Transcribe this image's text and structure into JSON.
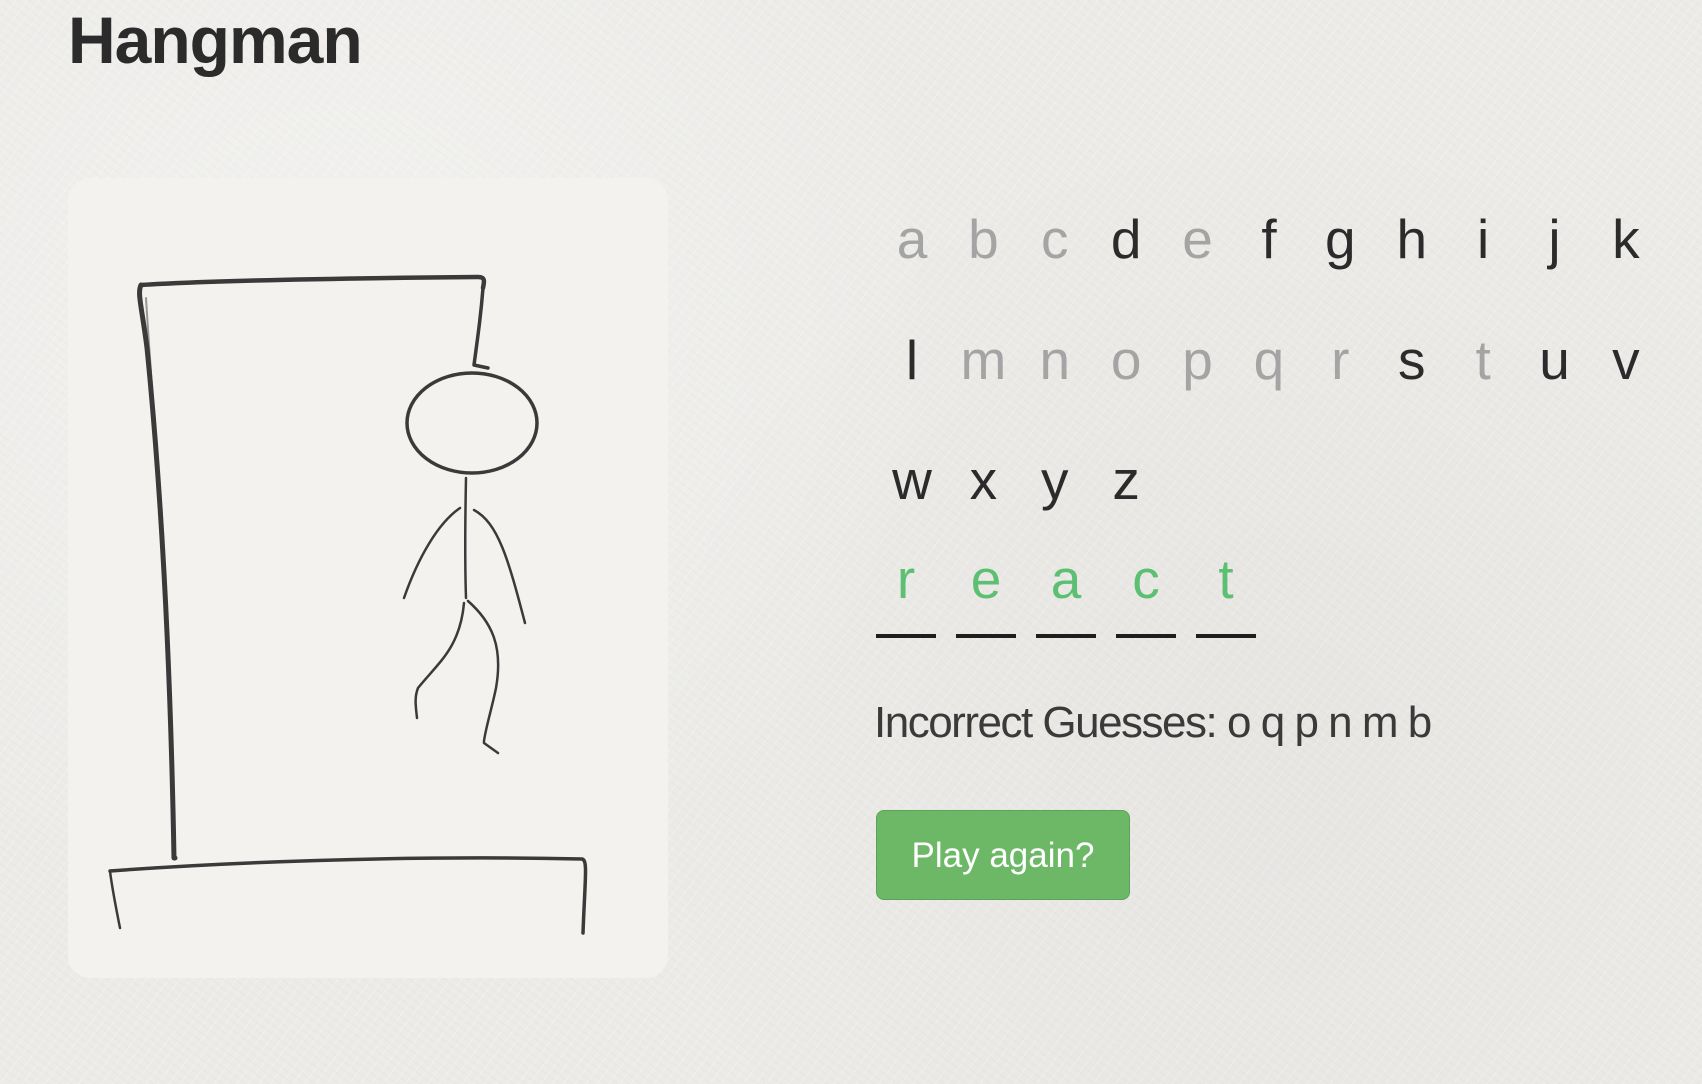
{
  "title": "Hangman",
  "alphabet": {
    "letters": [
      {
        "char": "a",
        "used": true
      },
      {
        "char": "b",
        "used": true
      },
      {
        "char": "c",
        "used": true
      },
      {
        "char": "d",
        "used": false
      },
      {
        "char": "e",
        "used": true
      },
      {
        "char": "f",
        "used": false
      },
      {
        "char": "g",
        "used": false
      },
      {
        "char": "h",
        "used": false
      },
      {
        "char": "i",
        "used": false
      },
      {
        "char": "j",
        "used": false
      },
      {
        "char": "k",
        "used": false
      },
      {
        "char": "l",
        "used": false
      },
      {
        "char": "m",
        "used": true
      },
      {
        "char": "n",
        "used": true
      },
      {
        "char": "o",
        "used": true
      },
      {
        "char": "p",
        "used": true
      },
      {
        "char": "q",
        "used": true
      },
      {
        "char": "r",
        "used": true
      },
      {
        "char": "s",
        "used": false
      },
      {
        "char": "t",
        "used": true
      },
      {
        "char": "u",
        "used": false
      },
      {
        "char": "v",
        "used": false
      },
      {
        "char": "w",
        "used": false
      },
      {
        "char": "x",
        "used": false
      },
      {
        "char": "y",
        "used": false
      },
      {
        "char": "z",
        "used": false
      }
    ]
  },
  "word": {
    "letters": [
      "r",
      "e",
      "a",
      "c",
      "t"
    ]
  },
  "incorrect": {
    "label": "Incorrect Guesses:",
    "letters": [
      "o",
      "q",
      "p",
      "n",
      "m",
      "b"
    ]
  },
  "play_again": {
    "label": "Play again?"
  },
  "colors": {
    "background": "#ecebe8",
    "card": "#f3f2ef",
    "letter_available": "#2b2b2b",
    "letter_used": "#a4a4a4",
    "word_letter": "#5cbf72",
    "button": "#6cb867",
    "button_text": "#ffffff",
    "ink": "#3a3a3a"
  }
}
